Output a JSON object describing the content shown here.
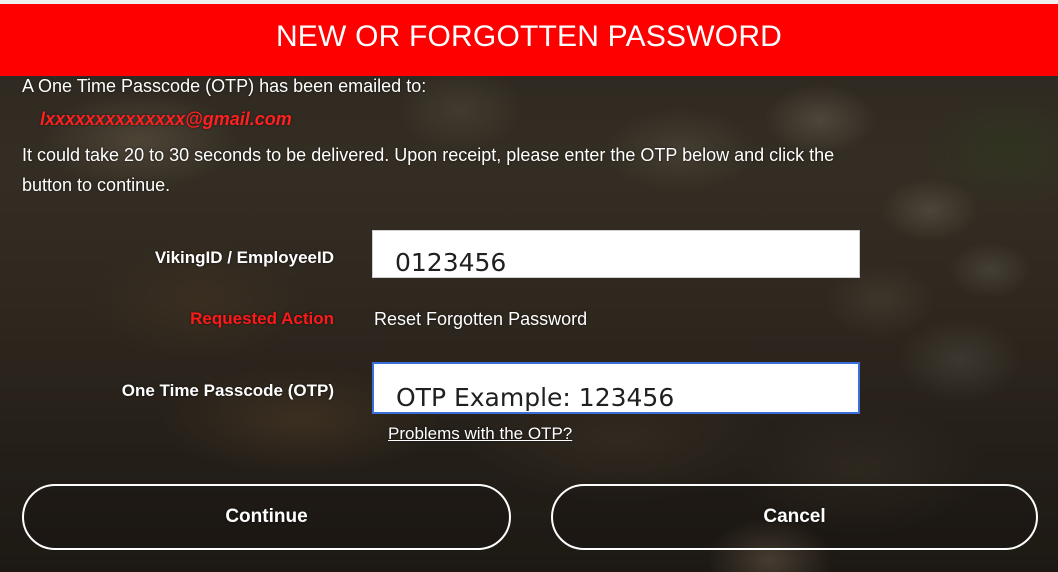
{
  "header": {
    "title": "NEW OR FORGOTTEN PASSWORD"
  },
  "message": {
    "line1": "A One Time Passcode (OTP) has been emailed to:",
    "email": "lxxxxxxxxxxxxxx@gmail.com",
    "line2": "It could take 20 to 30 seconds to be delivered. Upon receipt, please enter the OTP below and click the",
    "line3": "button to continue."
  },
  "form": {
    "id_label": "VikingID / EmployeeID",
    "id_value": "0123456",
    "action_label": "Requested Action",
    "action_value": "Reset Forgotten Password",
    "otp_label": "One Time Passcode (OTP)",
    "otp_value": "OTP Example: 123456",
    "otp_help_link": "Problems with the OTP?"
  },
  "buttons": {
    "continue_label": "Continue",
    "cancel_label": "Cancel"
  },
  "colors": {
    "header_bg": "#ff0000",
    "accent_red": "#ff1a1a",
    "input_focus_border": "#3a6fd8"
  }
}
